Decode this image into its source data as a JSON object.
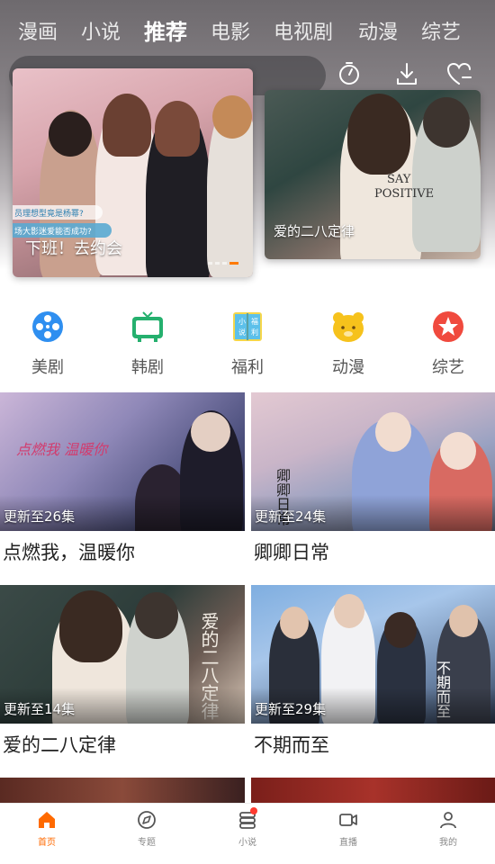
{
  "top_tabs": [
    {
      "label": "漫画",
      "active": false
    },
    {
      "label": "小说",
      "active": false
    },
    {
      "label": "推荐",
      "active": true
    },
    {
      "label": "电影",
      "active": false
    },
    {
      "label": "电视剧",
      "active": false
    },
    {
      "label": "动漫",
      "active": false
    },
    {
      "label": "综艺",
      "active": false
    }
  ],
  "header_icons": [
    "timer-icon",
    "download-icon",
    "favorites-heart-icon"
  ],
  "banners": [
    {
      "title": "下班！去约会",
      "caption_lines": [
        "员理想型竟是杨幂?",
        "场大影迷爱能否成功?"
      ]
    },
    {
      "title": "爱的二八定律",
      "shirt_text": [
        "SAY",
        "POSITIVE"
      ]
    }
  ],
  "categories": [
    {
      "label": "美剧",
      "icon": "film-reel-icon",
      "color": "#2f8ff0"
    },
    {
      "label": "韩剧",
      "icon": "tv-icon",
      "color": "#25b06e"
    },
    {
      "label": "福利",
      "icon": "welfare-book-icon",
      "color": "#2fb0e8",
      "icon_text": [
        "小",
        "说",
        "福",
        "利"
      ]
    },
    {
      "label": "动漫",
      "icon": "bear-face-icon",
      "color": "#f6c21c"
    },
    {
      "label": "综艺",
      "icon": "star-badge-icon",
      "color": "#f04a3e"
    }
  ],
  "cards": [
    {
      "title": "点燃我，温暖你",
      "update": "更新至26集",
      "poster_text": "点燃我 温暖你"
    },
    {
      "title": "卿卿日常",
      "update": "更新至24集",
      "poster_text": "卿卿日常"
    },
    {
      "title": "爱的二八定律",
      "update": "更新至14集",
      "poster_text": "爱的二八定律"
    },
    {
      "title": "不期而至",
      "update": "更新至29集",
      "poster_text": "不期而至"
    }
  ],
  "bottom_nav": [
    {
      "label": "首页",
      "icon": "home-icon",
      "active": true
    },
    {
      "label": "专题",
      "icon": "compass-icon",
      "active": false
    },
    {
      "label": "小说",
      "icon": "book-stack-icon",
      "active": false,
      "badge": true
    },
    {
      "label": "直播",
      "icon": "video-camera-icon",
      "active": false
    },
    {
      "label": "我的",
      "icon": "user-icon",
      "active": false
    }
  ],
  "colors": {
    "accent": "#ff6a00",
    "text": "#222222",
    "muted": "#888888"
  }
}
